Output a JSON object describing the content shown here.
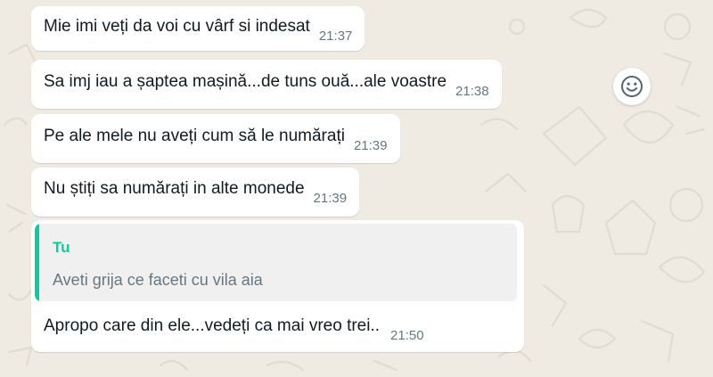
{
  "messages": [
    {
      "text": "Mie imi veți da voi cu vârf si indesat",
      "time": "21:37"
    },
    {
      "text": "Sa imj iau a șaptea mașină...de tuns ouă...ale voastre",
      "time": "21:38"
    },
    {
      "text": "Pe ale mele nu aveți cum să le numărați",
      "time": "21:39"
    },
    {
      "text": "Nu știți sa numărați in alte monede",
      "time": "21:39"
    }
  ],
  "reply_message": {
    "quoted_author": "Tu",
    "quoted_text": "Aveti grija ce faceti cu vila aia",
    "text": "Apropo care din ele...vedeți ca mai vreo trei..",
    "time": "21:50"
  },
  "icons": {
    "react_button": "smiley-icon"
  },
  "colors": {
    "background": "#efeae2",
    "bubble": "#ffffff",
    "quote_accent": "#06cf9c",
    "timestamp": "#667781"
  }
}
